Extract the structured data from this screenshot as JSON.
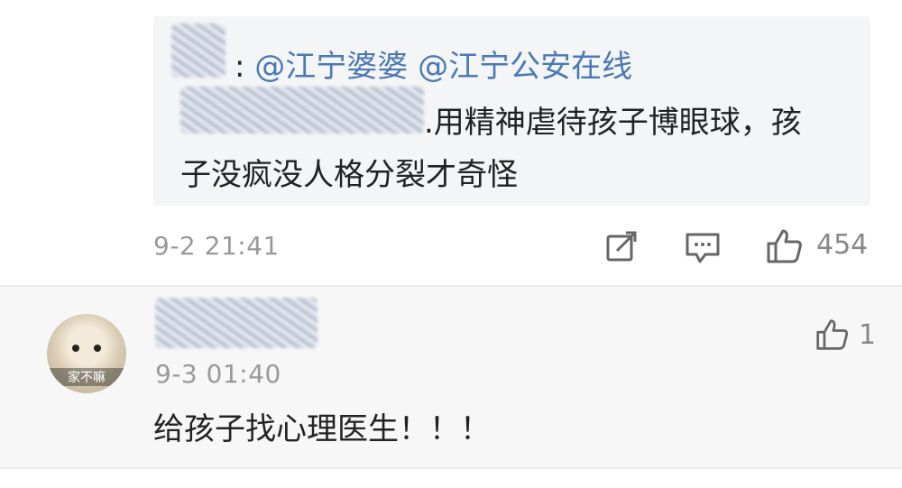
{
  "quote": {
    "line1_suffix": ": ",
    "mention1": "@江宁婆婆",
    "mention2": "@江宁公安在线",
    "line2": ".用精神虐待孩子博眼球，孩",
    "line3": "子没疯没人格分裂才奇怪"
  },
  "post": {
    "time": "9-2 21:41",
    "likes": "454",
    "icons": [
      "share-icon",
      "comment-icon",
      "like-icon"
    ]
  },
  "reply": {
    "avatar_caption": "家不嘛",
    "time": "9-3 01:40",
    "likes": "1",
    "text": "给孩子找心理医生！！！"
  },
  "colors": {
    "mention": "#4a79b5",
    "muted": "#999999",
    "reply_bg": "#f7f7f8",
    "quote_bg": "#f4f5f7"
  }
}
